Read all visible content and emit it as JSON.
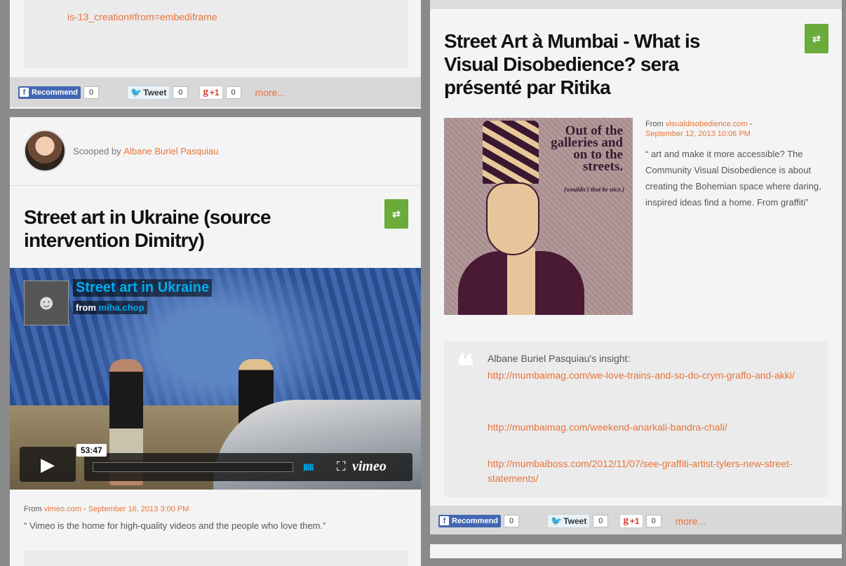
{
  "left_top": {
    "embed_url_fragment": "is-13_creation#from=embediframe"
  },
  "share": {
    "recommend_label": "Recommend",
    "recommend_count": "0",
    "tweet_label": "Tweet",
    "tweet_count": "0",
    "gplus_label": "+1",
    "gplus_count": "0",
    "more_label": "more..."
  },
  "left_post": {
    "scooped_prefix": "Scooped by",
    "scooped_author": "Albane Buriel Pasquiau",
    "title": "Street art in Ukraine (source intervention Dimitry)",
    "video": {
      "title": "Street art in Ukraine",
      "from_prefix": "from",
      "from_user": "miha.chop",
      "duration": "53:47",
      "brand": "vimeo"
    },
    "source_prefix": "From",
    "source_site": "vimeo.com",
    "source_date": "September 16, 2013 3:00 PM",
    "excerpt": "“ Vimeo is the home for high-quality videos and the people who love them.”"
  },
  "right_post": {
    "title": "Street Art à Mumbai - What is Visual Disobedience? sera présenté par Ritika",
    "poster_text": "Out of the galleries and on to the streets.",
    "poster_sub": "(wouldn't that be nice.)",
    "source_prefix": "From",
    "source_site": "visualdisobedience.com",
    "source_date": "September 12, 2013 10:06 PM",
    "excerpt": "“ art and make it more accessible? The Community Visual Disobedience is about creating the Bohemian space where daring, inspired ideas find a home. From graffiti”",
    "insight_head": "Albane Buriel Pasquiau's insight:",
    "insight_links": [
      "http://mumbaimag.com/we-love-trains-and-so-do-crym-graffo-and-akki/",
      "http://mumbaimag.com/weekend-anarkali-bandra-chali/",
      "http://mumbaiboss.com/2012/11/07/see-graffiti-artist-tylers-new-street-statements/"
    ]
  },
  "colors": {
    "accent": "#e8743b",
    "rescoop_green": "#6aab3a",
    "facebook_blue": "#4267b2",
    "vimeo_blue": "#00adef"
  }
}
